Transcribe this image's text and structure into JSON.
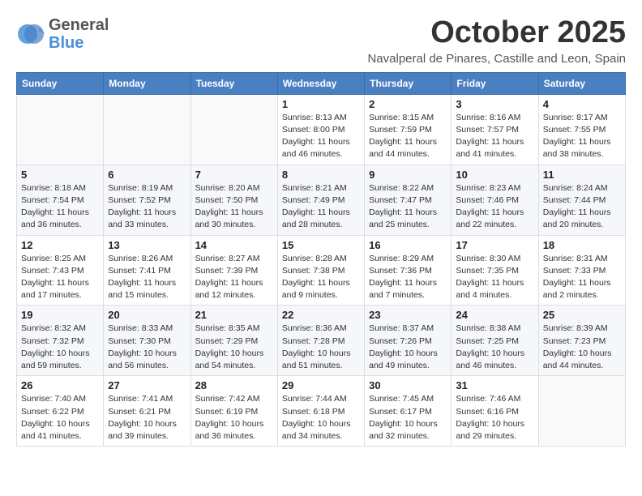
{
  "header": {
    "logo_general": "General",
    "logo_blue": "Blue",
    "month": "October 2025",
    "location": "Navalperal de Pinares, Castille and Leon, Spain"
  },
  "weekdays": [
    "Sunday",
    "Monday",
    "Tuesday",
    "Wednesday",
    "Thursday",
    "Friday",
    "Saturday"
  ],
  "weeks": [
    [
      {
        "day": "",
        "sunrise": "",
        "sunset": "",
        "daylight": ""
      },
      {
        "day": "",
        "sunrise": "",
        "sunset": "",
        "daylight": ""
      },
      {
        "day": "",
        "sunrise": "",
        "sunset": "",
        "daylight": ""
      },
      {
        "day": "1",
        "sunrise": "Sunrise: 8:13 AM",
        "sunset": "Sunset: 8:00 PM",
        "daylight": "Daylight: 11 hours and 46 minutes."
      },
      {
        "day": "2",
        "sunrise": "Sunrise: 8:15 AM",
        "sunset": "Sunset: 7:59 PM",
        "daylight": "Daylight: 11 hours and 44 minutes."
      },
      {
        "day": "3",
        "sunrise": "Sunrise: 8:16 AM",
        "sunset": "Sunset: 7:57 PM",
        "daylight": "Daylight: 11 hours and 41 minutes."
      },
      {
        "day": "4",
        "sunrise": "Sunrise: 8:17 AM",
        "sunset": "Sunset: 7:55 PM",
        "daylight": "Daylight: 11 hours and 38 minutes."
      }
    ],
    [
      {
        "day": "5",
        "sunrise": "Sunrise: 8:18 AM",
        "sunset": "Sunset: 7:54 PM",
        "daylight": "Daylight: 11 hours and 36 minutes."
      },
      {
        "day": "6",
        "sunrise": "Sunrise: 8:19 AM",
        "sunset": "Sunset: 7:52 PM",
        "daylight": "Daylight: 11 hours and 33 minutes."
      },
      {
        "day": "7",
        "sunrise": "Sunrise: 8:20 AM",
        "sunset": "Sunset: 7:50 PM",
        "daylight": "Daylight: 11 hours and 30 minutes."
      },
      {
        "day": "8",
        "sunrise": "Sunrise: 8:21 AM",
        "sunset": "Sunset: 7:49 PM",
        "daylight": "Daylight: 11 hours and 28 minutes."
      },
      {
        "day": "9",
        "sunrise": "Sunrise: 8:22 AM",
        "sunset": "Sunset: 7:47 PM",
        "daylight": "Daylight: 11 hours and 25 minutes."
      },
      {
        "day": "10",
        "sunrise": "Sunrise: 8:23 AM",
        "sunset": "Sunset: 7:46 PM",
        "daylight": "Daylight: 11 hours and 22 minutes."
      },
      {
        "day": "11",
        "sunrise": "Sunrise: 8:24 AM",
        "sunset": "Sunset: 7:44 PM",
        "daylight": "Daylight: 11 hours and 20 minutes."
      }
    ],
    [
      {
        "day": "12",
        "sunrise": "Sunrise: 8:25 AM",
        "sunset": "Sunset: 7:43 PM",
        "daylight": "Daylight: 11 hours and 17 minutes."
      },
      {
        "day": "13",
        "sunrise": "Sunrise: 8:26 AM",
        "sunset": "Sunset: 7:41 PM",
        "daylight": "Daylight: 11 hours and 15 minutes."
      },
      {
        "day": "14",
        "sunrise": "Sunrise: 8:27 AM",
        "sunset": "Sunset: 7:39 PM",
        "daylight": "Daylight: 11 hours and 12 minutes."
      },
      {
        "day": "15",
        "sunrise": "Sunrise: 8:28 AM",
        "sunset": "Sunset: 7:38 PM",
        "daylight": "Daylight: 11 hours and 9 minutes."
      },
      {
        "day": "16",
        "sunrise": "Sunrise: 8:29 AM",
        "sunset": "Sunset: 7:36 PM",
        "daylight": "Daylight: 11 hours and 7 minutes."
      },
      {
        "day": "17",
        "sunrise": "Sunrise: 8:30 AM",
        "sunset": "Sunset: 7:35 PM",
        "daylight": "Daylight: 11 hours and 4 minutes."
      },
      {
        "day": "18",
        "sunrise": "Sunrise: 8:31 AM",
        "sunset": "Sunset: 7:33 PM",
        "daylight": "Daylight: 11 hours and 2 minutes."
      }
    ],
    [
      {
        "day": "19",
        "sunrise": "Sunrise: 8:32 AM",
        "sunset": "Sunset: 7:32 PM",
        "daylight": "Daylight: 10 hours and 59 minutes."
      },
      {
        "day": "20",
        "sunrise": "Sunrise: 8:33 AM",
        "sunset": "Sunset: 7:30 PM",
        "daylight": "Daylight: 10 hours and 56 minutes."
      },
      {
        "day": "21",
        "sunrise": "Sunrise: 8:35 AM",
        "sunset": "Sunset: 7:29 PM",
        "daylight": "Daylight: 10 hours and 54 minutes."
      },
      {
        "day": "22",
        "sunrise": "Sunrise: 8:36 AM",
        "sunset": "Sunset: 7:28 PM",
        "daylight": "Daylight: 10 hours and 51 minutes."
      },
      {
        "day": "23",
        "sunrise": "Sunrise: 8:37 AM",
        "sunset": "Sunset: 7:26 PM",
        "daylight": "Daylight: 10 hours and 49 minutes."
      },
      {
        "day": "24",
        "sunrise": "Sunrise: 8:38 AM",
        "sunset": "Sunset: 7:25 PM",
        "daylight": "Daylight: 10 hours and 46 minutes."
      },
      {
        "day": "25",
        "sunrise": "Sunrise: 8:39 AM",
        "sunset": "Sunset: 7:23 PM",
        "daylight": "Daylight: 10 hours and 44 minutes."
      }
    ],
    [
      {
        "day": "26",
        "sunrise": "Sunrise: 7:40 AM",
        "sunset": "Sunset: 6:22 PM",
        "daylight": "Daylight: 10 hours and 41 minutes."
      },
      {
        "day": "27",
        "sunrise": "Sunrise: 7:41 AM",
        "sunset": "Sunset: 6:21 PM",
        "daylight": "Daylight: 10 hours and 39 minutes."
      },
      {
        "day": "28",
        "sunrise": "Sunrise: 7:42 AM",
        "sunset": "Sunset: 6:19 PM",
        "daylight": "Daylight: 10 hours and 36 minutes."
      },
      {
        "day": "29",
        "sunrise": "Sunrise: 7:44 AM",
        "sunset": "Sunset: 6:18 PM",
        "daylight": "Daylight: 10 hours and 34 minutes."
      },
      {
        "day": "30",
        "sunrise": "Sunrise: 7:45 AM",
        "sunset": "Sunset: 6:17 PM",
        "daylight": "Daylight: 10 hours and 32 minutes."
      },
      {
        "day": "31",
        "sunrise": "Sunrise: 7:46 AM",
        "sunset": "Sunset: 6:16 PM",
        "daylight": "Daylight: 10 hours and 29 minutes."
      },
      {
        "day": "",
        "sunrise": "",
        "sunset": "",
        "daylight": ""
      }
    ]
  ]
}
